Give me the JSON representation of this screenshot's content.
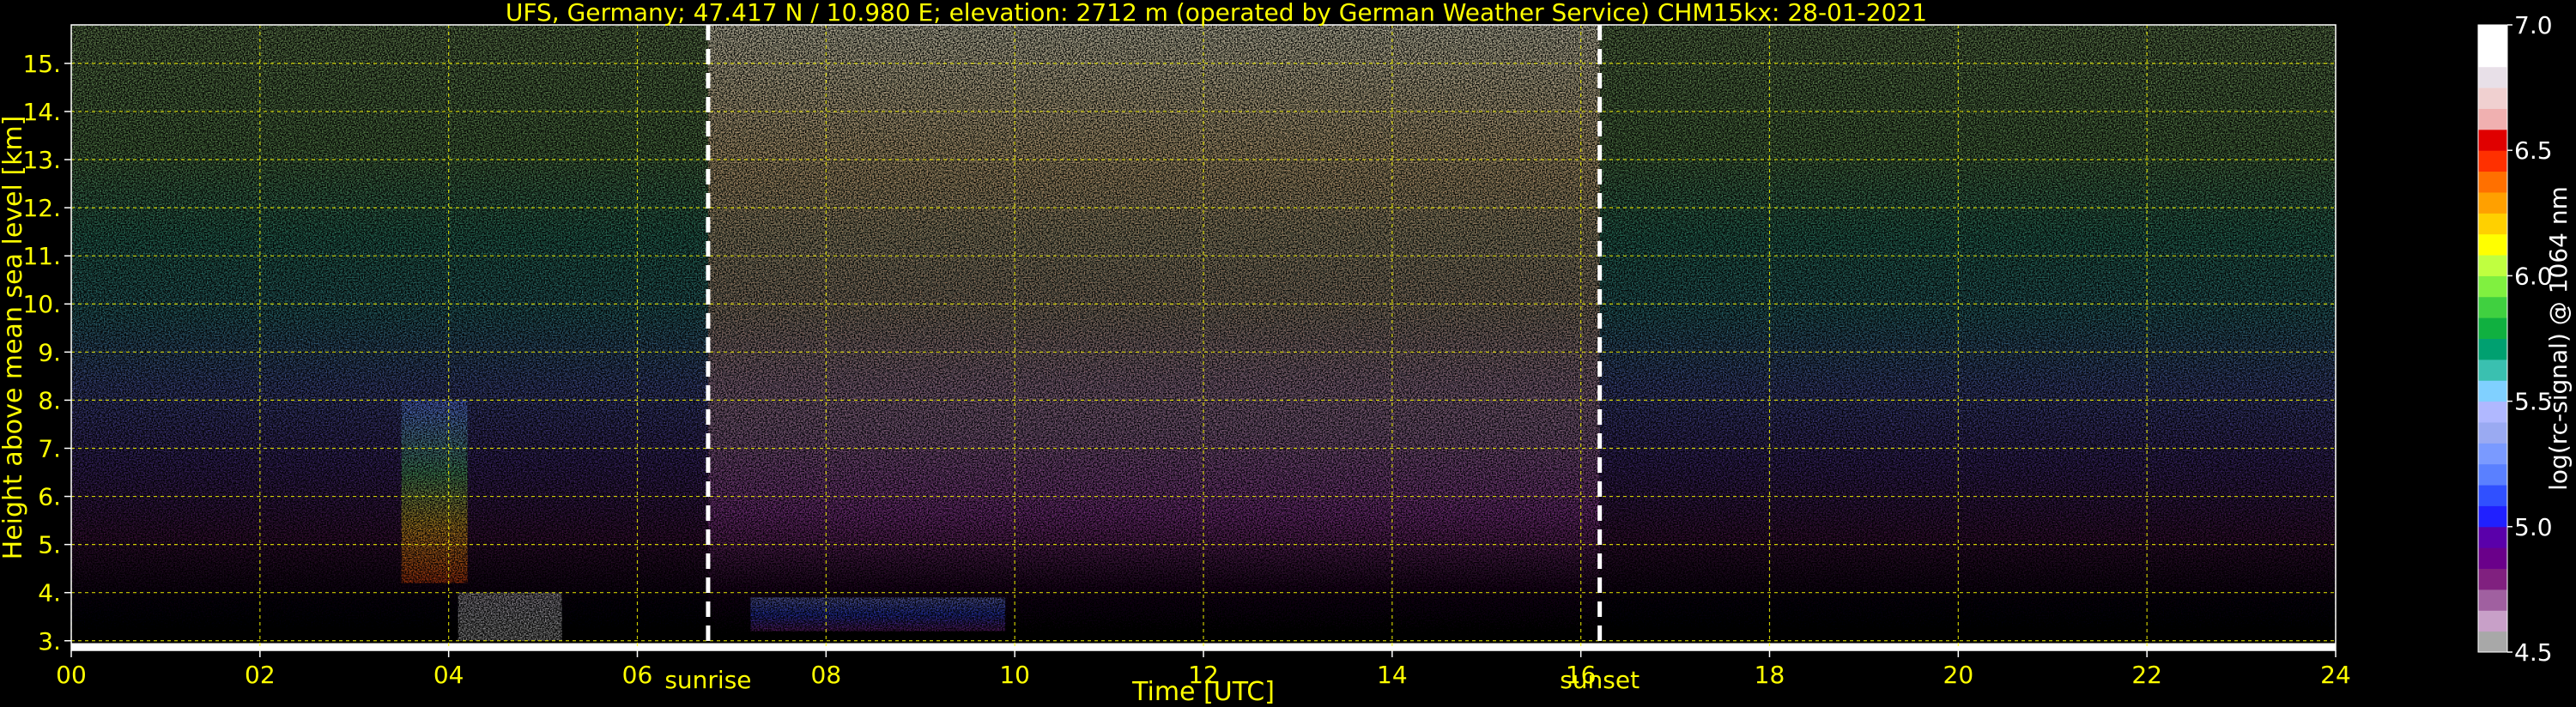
{
  "chart_data": {
    "type": "heatmap",
    "title": "UFS, Germany; 47.417 N / 10.980 E; elevation: 2712 m  (operated by German Weather Service)    CHM15kx: 28-01-2021",
    "xlabel": "Time [UTC]",
    "ylabel": "Height above mean sea level [km]",
    "xlim": [
      0,
      24
    ],
    "ylim": [
      2.8,
      15.8
    ],
    "x_ticks": [
      "00",
      "02",
      "04",
      "06",
      "08",
      "10",
      "12",
      "14",
      "16",
      "18",
      "20",
      "22",
      "24"
    ],
    "x_tick_values": [
      0,
      2,
      4,
      6,
      8,
      10,
      12,
      14,
      16,
      18,
      20,
      22,
      24
    ],
    "y_ticks": [
      "3.",
      "4.",
      "5.",
      "6.",
      "7.",
      "8.",
      "9.",
      "10.",
      "11.",
      "12.",
      "13.",
      "14.",
      "15."
    ],
    "y_tick_values": [
      3,
      4,
      5,
      6,
      7,
      8,
      9,
      10,
      11,
      12,
      13,
      14,
      15
    ],
    "grid": true,
    "annotations": [
      {
        "text": "sunrise",
        "x": 6.75
      },
      {
        "text": "sunset",
        "x": 16.2
      }
    ],
    "colorbar": {
      "label": "log(rc-signal) @ 1064 nm",
      "range": [
        4.5,
        7.0
      ],
      "ticks": [
        "4.5",
        "5.0",
        "5.5",
        "6.0",
        "6.5",
        "7.0"
      ],
      "tick_values": [
        4.5,
        5.0,
        5.5,
        6.0,
        6.5,
        7.0
      ],
      "colors": [
        "#a8a8a8",
        "#c8a0c8",
        "#a060a0",
        "#80207f",
        "#6a008a",
        "#5a00aa",
        "#2020ff",
        "#3050ff",
        "#5a80ff",
        "#7a9aff",
        "#9aaaf2",
        "#b0b8ff",
        "#80d0ff",
        "#3ac0b0",
        "#00a070",
        "#10b040",
        "#40d040",
        "#80f040",
        "#c0ff40",
        "#ffff00",
        "#ffd000",
        "#ffa000",
        "#ff7000",
        "#ff3000",
        "#e00000",
        "#f0b0b0",
        "#f0d0d0",
        "#e8e0e8",
        "#ffffff",
        "#ffffff"
      ]
    },
    "features": [
      {
        "name": "ground return",
        "x": [
          0,
          24
        ],
        "height": [
          2.8,
          2.95
        ]
      },
      {
        "name": "cloud layer",
        "x": [
          3.5,
          4.2
        ],
        "height": [
          4.2,
          8.0
        ]
      },
      {
        "name": "lower cloud",
        "x": [
          4.1,
          5.2
        ],
        "height": [
          3.0,
          4.0
        ]
      },
      {
        "name": "boundary layer",
        "x": [
          7.2,
          9.9
        ],
        "height": [
          3.2,
          3.9
        ]
      }
    ]
  }
}
